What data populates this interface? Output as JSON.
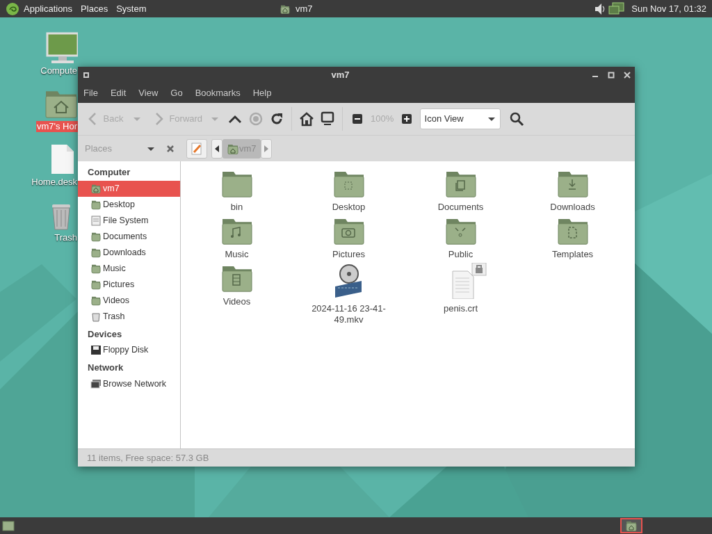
{
  "top_panel": {
    "menus": [
      "Applications",
      "Places",
      "System"
    ],
    "task": "vm7",
    "clock": "Sun Nov 17, 01:32"
  },
  "desktop_icons": [
    {
      "label": "Compute",
      "kind": "computer",
      "selected": false
    },
    {
      "label": "vm7's Hor",
      "kind": "home",
      "selected": true
    },
    {
      "label": "Home.desk",
      "kind": "file",
      "selected": false
    },
    {
      "label": "Trash",
      "kind": "trash",
      "selected": false
    }
  ],
  "window": {
    "title": "vm7",
    "menu": [
      "File",
      "Edit",
      "View",
      "Go",
      "Bookmarks",
      "Help"
    ],
    "toolbar": {
      "back": {
        "label": "Back",
        "disabled": true
      },
      "forward": {
        "label": "Forward",
        "disabled": true
      },
      "zoom": "100%",
      "view": "Icon View"
    },
    "sidebar": {
      "title": "Places",
      "sections": [
        {
          "heading": "Computer",
          "items": [
            {
              "label": "vm7",
              "kind": "home",
              "selected": true
            },
            {
              "label": "Desktop",
              "kind": "folder",
              "selected": false
            },
            {
              "label": "File System",
              "kind": "drive",
              "selected": false
            },
            {
              "label": "Documents",
              "kind": "folder",
              "selected": false
            },
            {
              "label": "Downloads",
              "kind": "folder",
              "selected": false
            },
            {
              "label": "Music",
              "kind": "folder",
              "selected": false
            },
            {
              "label": "Pictures",
              "kind": "folder",
              "selected": false
            },
            {
              "label": "Videos",
              "kind": "folder",
              "selected": false
            },
            {
              "label": "Trash",
              "kind": "trash",
              "selected": false
            }
          ]
        },
        {
          "heading": "Devices",
          "items": [
            {
              "label": "Floppy Disk",
              "kind": "floppy",
              "selected": false
            }
          ]
        },
        {
          "heading": "Network",
          "items": [
            {
              "label": "Browse Network",
              "kind": "network",
              "selected": false
            }
          ]
        }
      ]
    },
    "path": [
      {
        "label": "vm7",
        "selected": true
      }
    ],
    "files": [
      {
        "name": "bin",
        "kind": "folder"
      },
      {
        "name": "Desktop",
        "kind": "desktop"
      },
      {
        "name": "Documents",
        "kind": "documents"
      },
      {
        "name": "Downloads",
        "kind": "downloads"
      },
      {
        "name": "Music",
        "kind": "music"
      },
      {
        "name": "Pictures",
        "kind": "pictures"
      },
      {
        "name": "Public",
        "kind": "public"
      },
      {
        "name": "Templates",
        "kind": "templates"
      },
      {
        "name": "Videos",
        "kind": "videos"
      },
      {
        "name": "2024-11-16 23-41-49.mkv",
        "kind": "video"
      },
      {
        "name": "penis.crt",
        "kind": "certificate"
      }
    ],
    "status": "11 items, Free space: 57.3 GB"
  },
  "bottom_panel": {
    "tasks": [
      {
        "kind": "home",
        "selected": true
      }
    ]
  }
}
